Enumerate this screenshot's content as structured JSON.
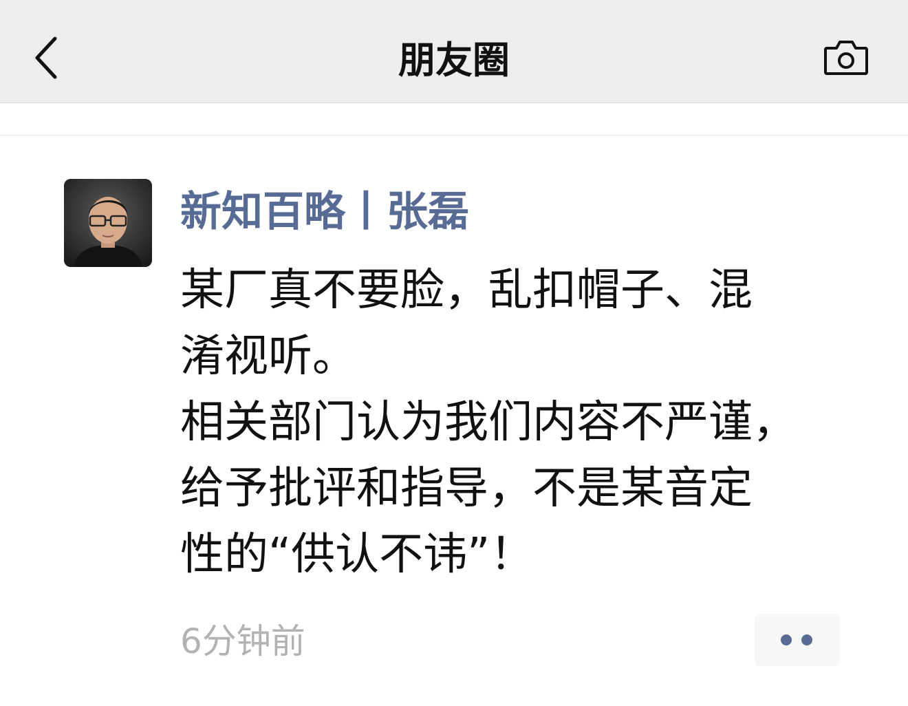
{
  "navbar": {
    "title": "朋友圈",
    "back_icon": "chevron-left-icon",
    "camera_icon": "camera-icon"
  },
  "post": {
    "author": "新知百略丨张磊",
    "body": "某厂真不要脸，乱扣帽子、混\n淆视听。\n相关部门认为我们内容不严谨，\n给予批评和指导，不是某音定\n性的“供认不讳”！",
    "time": "6分钟前",
    "more_icon": "more-dots-icon"
  },
  "colors": {
    "navbar_bg": "#ededed",
    "author_link": "#576b95",
    "timestamp": "#b2b2b2",
    "text": "#111111"
  }
}
